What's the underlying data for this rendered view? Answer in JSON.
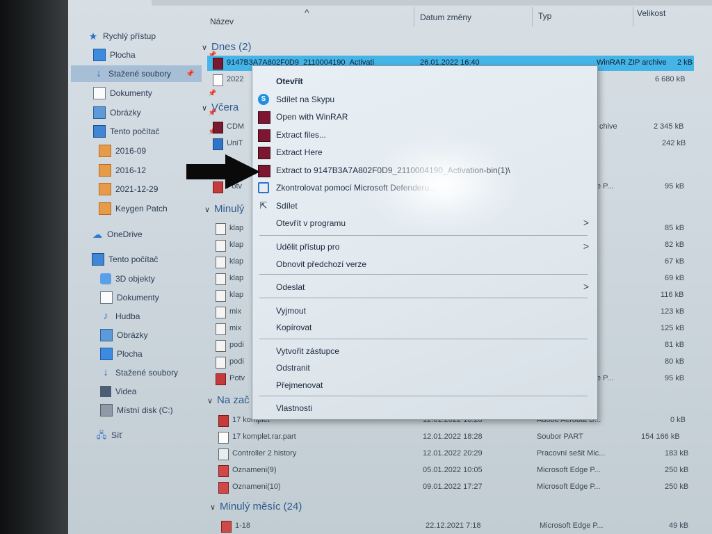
{
  "header": {
    "col_name": "Název",
    "col_date": "Datum změny",
    "col_type": "Typ",
    "col_size": "Velikost"
  },
  "sidebar": {
    "items": [
      {
        "label": "Rychlý přístup",
        "icon": "star-icon"
      },
      {
        "label": "Plocha",
        "icon": "desktop-icon"
      },
      {
        "label": "Stažené soubory",
        "icon": "download-icon"
      },
      {
        "label": "Dokumenty",
        "icon": "document-icon"
      },
      {
        "label": "Obrázky",
        "icon": "pictures-icon"
      },
      {
        "label": "Tento počítač",
        "icon": "computer-icon"
      },
      {
        "label": "2016-09",
        "icon": "folder-icon"
      },
      {
        "label": "2016-12",
        "icon": "folder-icon"
      },
      {
        "label": "2021-12-29",
        "icon": "folder-icon"
      },
      {
        "label": "Keygen Patch",
        "icon": "folder-icon"
      },
      {
        "label": "OneDrive",
        "icon": "cloud-icon"
      },
      {
        "label": "Tento počítač",
        "icon": "computer-icon"
      },
      {
        "label": "3D objekty",
        "icon": "cube-icon"
      },
      {
        "label": "Dokumenty",
        "icon": "document-icon"
      },
      {
        "label": "Hudba",
        "icon": "music-icon"
      },
      {
        "label": "Obrázky",
        "icon": "pictures-icon"
      },
      {
        "label": "Plocha",
        "icon": "desktop-icon"
      },
      {
        "label": "Stažené soubory",
        "icon": "download-icon"
      },
      {
        "label": "Videa",
        "icon": "video-icon"
      },
      {
        "label": "Místní disk (C:)",
        "icon": "disk-icon"
      },
      {
        "label": "Síť",
        "icon": "network-icon"
      }
    ]
  },
  "groups": {
    "dnes": "Dnes (2)",
    "vcera": "Včera",
    "minuly": "Minulý",
    "na_zac": "Na zač",
    "minuly_mesic": "Minulý měsíc (24)"
  },
  "rows": {
    "r1": {
      "name": "9147B3A7A802F0D9_2110004190_Activati",
      "date": "26.01.2022 16:40",
      "type": "WinRAR ZIP archive",
      "size": "2 kB"
    },
    "r2": {
      "name": "2022",
      "size": "6 680 kB"
    },
    "r3": {
      "name": "CDM",
      "type": "chive",
      "size": "2 345 kB"
    },
    "r4": {
      "name": "UniT",
      "size": "242 kB"
    },
    "r5": {
      "name": "Potv",
      "type": "e P...",
      "size": "95 kB"
    },
    "r6": {
      "name": "klap",
      "size": "85 kB"
    },
    "r7": {
      "name": "klap",
      "size": "82 kB"
    },
    "r8": {
      "name": "klap",
      "size": "67 kB"
    },
    "r9": {
      "name": "klap",
      "size": "69 kB"
    },
    "r10": {
      "name": "klap",
      "size": "116 kB"
    },
    "r11": {
      "name": "mix",
      "size": "123 kB"
    },
    "r12": {
      "name": "mix",
      "size": "125 kB"
    },
    "r13": {
      "name": "podi",
      "size": "81 kB"
    },
    "r14": {
      "name": "podi",
      "size": "80 kB"
    },
    "r15": {
      "name": "Potv",
      "type": "e P...",
      "size": "95 kB"
    },
    "r16": {
      "name": "17 komplet",
      "date": "12.01.2022 18:28",
      "type": "Adobe Acrobat D...",
      "size": "0 kB"
    },
    "r17": {
      "name": "17 komplet.rar.part",
      "date": "12.01.2022 18:28",
      "type": "Soubor PART",
      "size": "154 166 kB"
    },
    "r18": {
      "name": "Controller 2 history",
      "date": "12.01.2022 20:29",
      "type": "Pracovní sešit Mic...",
      "size": "183 kB"
    },
    "r19": {
      "name": "Oznameni(9)",
      "date": "05.01.2022 10:05",
      "type": "Microsoft Edge P...",
      "size": "250 kB"
    },
    "r20": {
      "name": "Oznameni(10)",
      "date": "09.01.2022 17:27",
      "type": "Microsoft Edge P...",
      "size": "250 kB"
    },
    "r21": {
      "name": "1-18",
      "date": "22.12.2021 7:18",
      "type": "Microsoft Edge P...",
      "size": "49 kB"
    }
  },
  "menu": {
    "open": "Otevřít",
    "skype": "Sdílet na Skypu",
    "open_winrar": "Open with WinRAR",
    "extract_files": "Extract files...",
    "extract_here": "Extract Here",
    "extract_to": "Extract to 9147B3A7A802F0D9_2110004190_Activation-bin(1)\\",
    "scan": "Zkontrolovat pomocí Microsoft Defenderu...",
    "share": "Sdílet",
    "open_with": "Otevřít v programu",
    "grant_access": "Udělit přístup pro",
    "restore": "Obnovit předchozí verze",
    "send_to": "Odeslat",
    "cut": "Vyjmout",
    "copy": "Kopírovat",
    "shortcut": "Vytvořit zástupce",
    "delete": "Odstranit",
    "rename": "Přejmenovat",
    "properties": "Vlastnosti"
  },
  "colors": {
    "selection": "#45b4e6",
    "winrar": "#7d1731",
    "link_blue": "#315a8f"
  }
}
